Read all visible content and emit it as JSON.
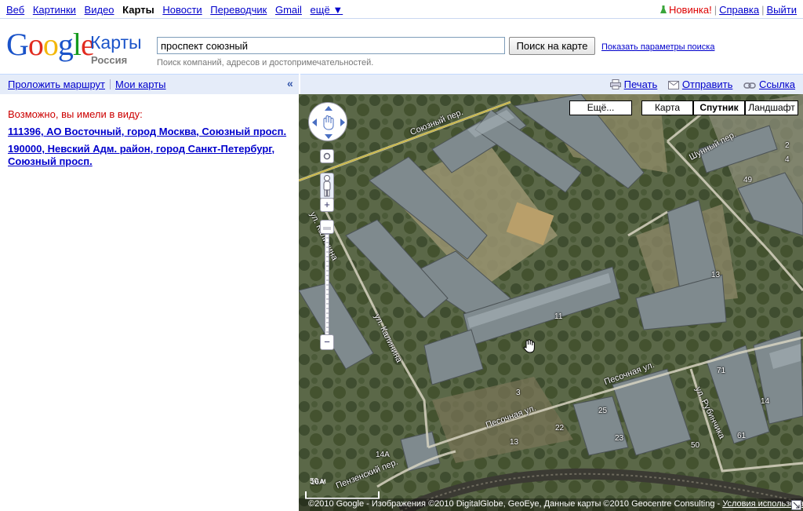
{
  "gbar": {
    "links": [
      "Веб",
      "Картинки",
      "Видео",
      "Карты",
      "Новости",
      "Переводчик",
      "Gmail",
      "ещё ▼"
    ],
    "active_index": 3,
    "new_label": "Новинка!",
    "help": "Справка",
    "logout": "Выйти"
  },
  "header": {
    "logo": "Google",
    "product": "Карты",
    "country": "Россия",
    "search_value": "проспект союзный",
    "search_button": "Поиск на карте",
    "show_options": "Показать параметры поиска",
    "hint": "Поиск компаний, адресов и достопримечательностей."
  },
  "toolbar": {
    "route": "Проложить маршрут",
    "mymaps": "Мои карты",
    "collapse": "«",
    "print": "Печать",
    "send": "Отправить",
    "link": "Ссылка"
  },
  "panel": {
    "did_you_mean": "Возможно, вы имели в виду:",
    "results": [
      "111396, АО Восточный, город Москва, Союзный просп.",
      "190000, Невский Адм. район, город Санкт-Петербург, Союзный просп."
    ]
  },
  "map": {
    "types": {
      "more": "Ещё...",
      "map": "Карта",
      "satellite": "Спутник",
      "terrain": "Ландшафт"
    },
    "selected_type": "Спутник",
    "zoom_in": "+",
    "zoom_out": "−",
    "streets": {
      "soyuzny": "Союзный пер.",
      "shunny": "Шунный пер.",
      "kalinina1": "ул. Калинина",
      "kalinina2": "ул. Калинина",
      "pesochnaya1": "Песочная ул.",
      "pesochnaya2": "Песочная ул.",
      "rubinchika": "ул. Рубинчика",
      "penzensky": "Пензенский пер."
    },
    "numbers": [
      "2",
      "4",
      "49",
      "13",
      "11",
      "3",
      "25",
      "22",
      "23",
      "13",
      "50",
      "71",
      "14",
      "61",
      "14A",
      "16A"
    ],
    "scale": "50 м",
    "copyright": "©2010 Google - Изображения ©2010 DigitalGlobe, GeoEye, Данные карты ©2010 Geocentre Consulting - ",
    "terms": "Условия использования"
  }
}
